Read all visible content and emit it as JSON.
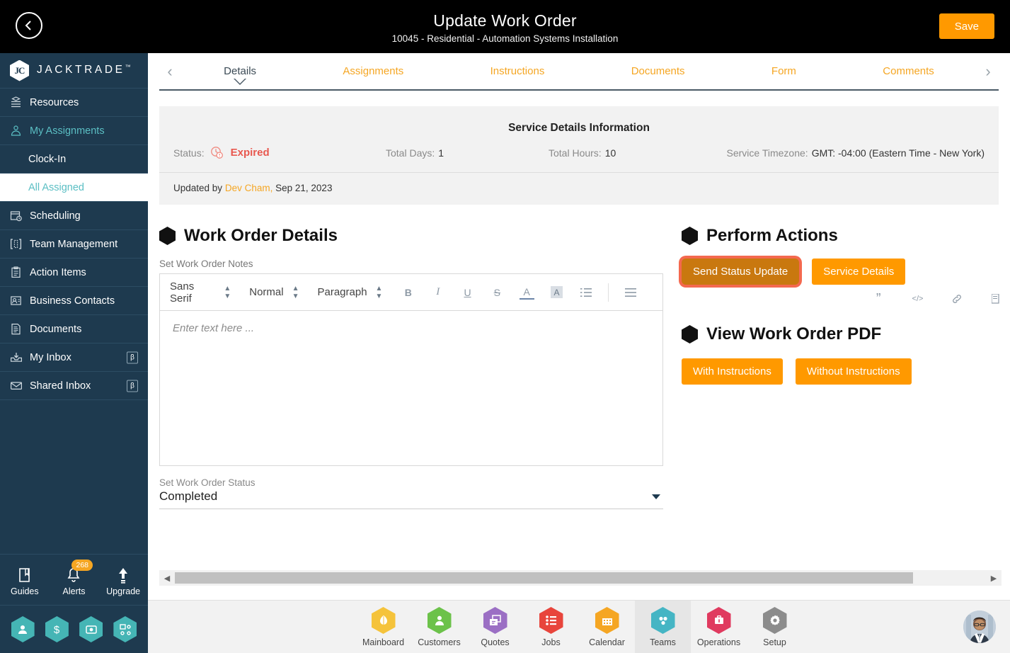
{
  "header": {
    "title": "Update Work Order",
    "subtitle": "10045 - Residential - Automation Systems Installation",
    "save_label": "Save",
    "back_icon": "back-arrow-circle-icon"
  },
  "sidebar": {
    "brand": "JACKTRADE",
    "brand_tm": "™",
    "items": [
      {
        "label": "Resources",
        "icon": "resources-icon",
        "type": "top",
        "state": "normal"
      },
      {
        "label": "My Assignments",
        "icon": "my-assignments-icon",
        "type": "top",
        "state": "active-parent"
      },
      {
        "label": "Clock-In",
        "icon": "",
        "type": "sub",
        "state": "normal"
      },
      {
        "label": "All Assigned",
        "icon": "",
        "type": "sub",
        "state": "selected"
      },
      {
        "label": "Scheduling",
        "icon": "calendar-clock-icon",
        "type": "top",
        "state": "normal"
      },
      {
        "label": "Team Management",
        "icon": "team-management-icon",
        "type": "top",
        "state": "normal"
      },
      {
        "label": "Action Items",
        "icon": "clipboard-icon",
        "type": "top",
        "state": "normal"
      },
      {
        "label": "Business Contacts",
        "icon": "contact-card-icon",
        "type": "top",
        "state": "normal"
      },
      {
        "label": "Documents",
        "icon": "documents-icon",
        "type": "top",
        "state": "normal"
      },
      {
        "label": "My Inbox",
        "icon": "inbox-down-icon",
        "type": "top",
        "state": "normal",
        "badge": "β"
      },
      {
        "label": "Shared Inbox",
        "icon": "envelope-icon",
        "type": "top",
        "state": "normal",
        "badge": "β"
      }
    ],
    "tools": [
      {
        "label": "Guides",
        "icon": "book-icon"
      },
      {
        "label": "Alerts",
        "icon": "bell-icon",
        "count": "268"
      },
      {
        "label": "Upgrade",
        "icon": "up-arrow-icon"
      }
    ],
    "quick_hexes": [
      {
        "icon": "person-icon"
      },
      {
        "icon": "dollar-icon"
      },
      {
        "icon": "money-transfer-icon"
      },
      {
        "icon": "workflow-icon"
      }
    ],
    "accent": "#5bbfc4",
    "background": "#1e3a4f"
  },
  "tabs": {
    "prev_icon": "chevron-left-icon",
    "next_icon": "chevron-right-icon",
    "items": [
      {
        "label": "Details",
        "active": true
      },
      {
        "label": "Assignments",
        "active": false
      },
      {
        "label": "Instructions",
        "active": false
      },
      {
        "label": "Documents",
        "active": false
      },
      {
        "label": "Form",
        "active": false
      },
      {
        "label": "Comments",
        "active": false
      }
    ]
  },
  "service_details": {
    "title": "Service Details Information",
    "status_label": "Status:",
    "status_value": "Expired",
    "status_icon": "clock-alert-icon",
    "total_days_label": "Total Days:",
    "total_days_value": "1",
    "total_hours_label": "Total Hours:",
    "total_hours_value": "10",
    "timezone_label": "Service Timezone:",
    "timezone_value": "GMT: -04:00 (Eastern Time - New York)",
    "updated_prefix": "Updated by",
    "updated_by": "Dev Cham,",
    "updated_date": "Sep 21, 2023",
    "status_color": "#e8584f"
  },
  "work_order_details": {
    "section_title": "Work Order Details",
    "notes_label": "Set Work Order Notes",
    "editor": {
      "font_family": "Sans Serif",
      "font_size": "Normal",
      "block_type": "Paragraph",
      "placeholder": "Enter text here ...",
      "buttons": [
        {
          "icon": "bold-icon",
          "glyph": "B"
        },
        {
          "icon": "italic-icon",
          "glyph": "I"
        },
        {
          "icon": "underline-icon",
          "glyph": "U"
        },
        {
          "icon": "strikethrough-icon",
          "glyph": "S"
        },
        {
          "icon": "text-color-icon",
          "glyph": "A"
        },
        {
          "icon": "highlight-color-icon",
          "glyph": "A"
        },
        {
          "icon": "ordered-list-icon",
          "glyph": "≡"
        },
        {
          "icon": "unordered-list-icon",
          "glyph": "≡"
        },
        {
          "icon": "blockquote-icon",
          "glyph": "”"
        },
        {
          "icon": "code-block-icon",
          "glyph": "</>"
        },
        {
          "icon": "link-icon",
          "glyph": "🔗"
        },
        {
          "icon": "image-icon",
          "glyph": "▤"
        }
      ]
    },
    "status_select_label": "Set Work Order Status",
    "status_select_value": "Completed"
  },
  "perform_actions": {
    "section_title": "Perform Actions",
    "buttons": [
      {
        "label": "Send Status Update",
        "highlighted": true
      },
      {
        "label": "Service Details",
        "highlighted": false
      }
    ]
  },
  "view_pdf": {
    "section_title": "View Work Order PDF",
    "buttons": [
      {
        "label": "With Instructions"
      },
      {
        "label": "Without Instructions"
      }
    ]
  },
  "scrollbar": {
    "left_arrow": "◀",
    "right_arrow": "▶"
  },
  "bottom_nav": {
    "items": [
      {
        "label": "Mainboard",
        "icon": "mainboard-icon",
        "color": "#f5c33b",
        "active": false
      },
      {
        "label": "Customers",
        "icon": "customers-icon",
        "color": "#6cc24a",
        "active": false
      },
      {
        "label": "Quotes",
        "icon": "quotes-icon",
        "color": "#9b6fc4",
        "active": false
      },
      {
        "label": "Jobs",
        "icon": "jobs-icon",
        "color": "#e8453c",
        "active": false
      },
      {
        "label": "Calendar",
        "icon": "calendar-icon",
        "color": "#f5a623",
        "active": false
      },
      {
        "label": "Teams",
        "icon": "teams-icon",
        "color": "#45b5c4",
        "active": true
      },
      {
        "label": "Operations",
        "icon": "operations-icon",
        "color": "#e03a5f",
        "active": false
      },
      {
        "label": "Setup",
        "icon": "setup-icon",
        "color": "#8c8c8c",
        "active": false
      }
    ],
    "avatar_icon": "user-avatar"
  },
  "colors": {
    "accent_orange": "#ff9900",
    "sidebar_bg": "#1e3a4f",
    "highlight_ring": "#f4694f"
  }
}
